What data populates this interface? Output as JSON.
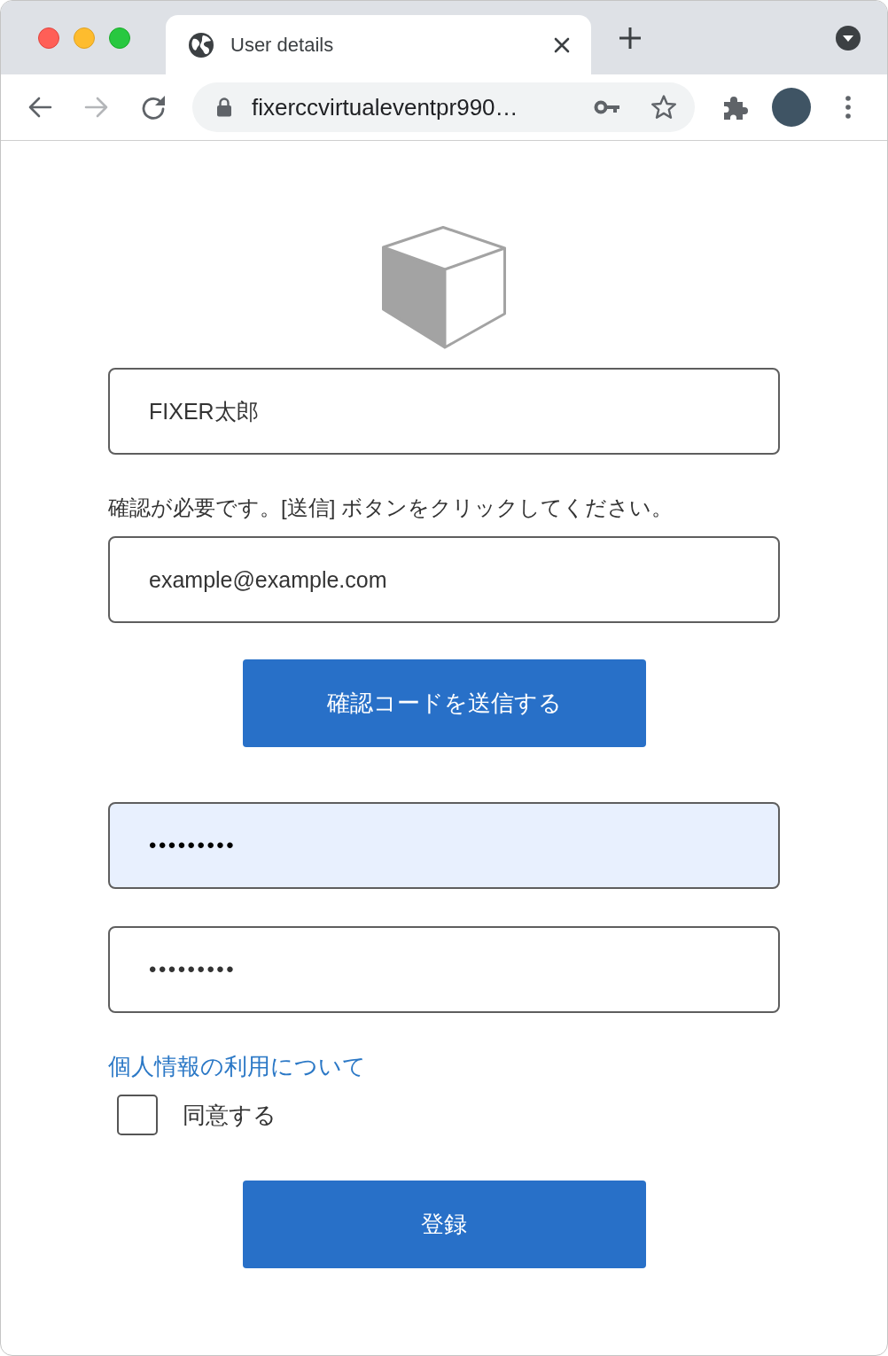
{
  "tab": {
    "title": "User details"
  },
  "toolbar": {
    "buttons": [
      {
        "kind": "back",
        "disabled": false
      },
      {
        "kind": "forward",
        "disabled": true
      },
      {
        "kind": "reload",
        "disabled": false
      }
    ],
    "url": "fixerccvirtualeventpr990…"
  },
  "form": {
    "name_field": {
      "value": "FIXER太郎"
    },
    "instruction": "確認が必要です。[送信] ボタンをクリックしてください。",
    "email_field": {
      "value": "example@example.com"
    },
    "send_code_button": "確認コードを送信する",
    "password_field": {
      "value": "•••••••••",
      "autofilled": true
    },
    "confirm_password_field": {
      "value": "•••••••••",
      "autofilled": false
    },
    "privacy_link": "個人情報の利用について",
    "agree_checkbox": {
      "label": "同意する",
      "checked": false
    },
    "register_button": "登録"
  }
}
